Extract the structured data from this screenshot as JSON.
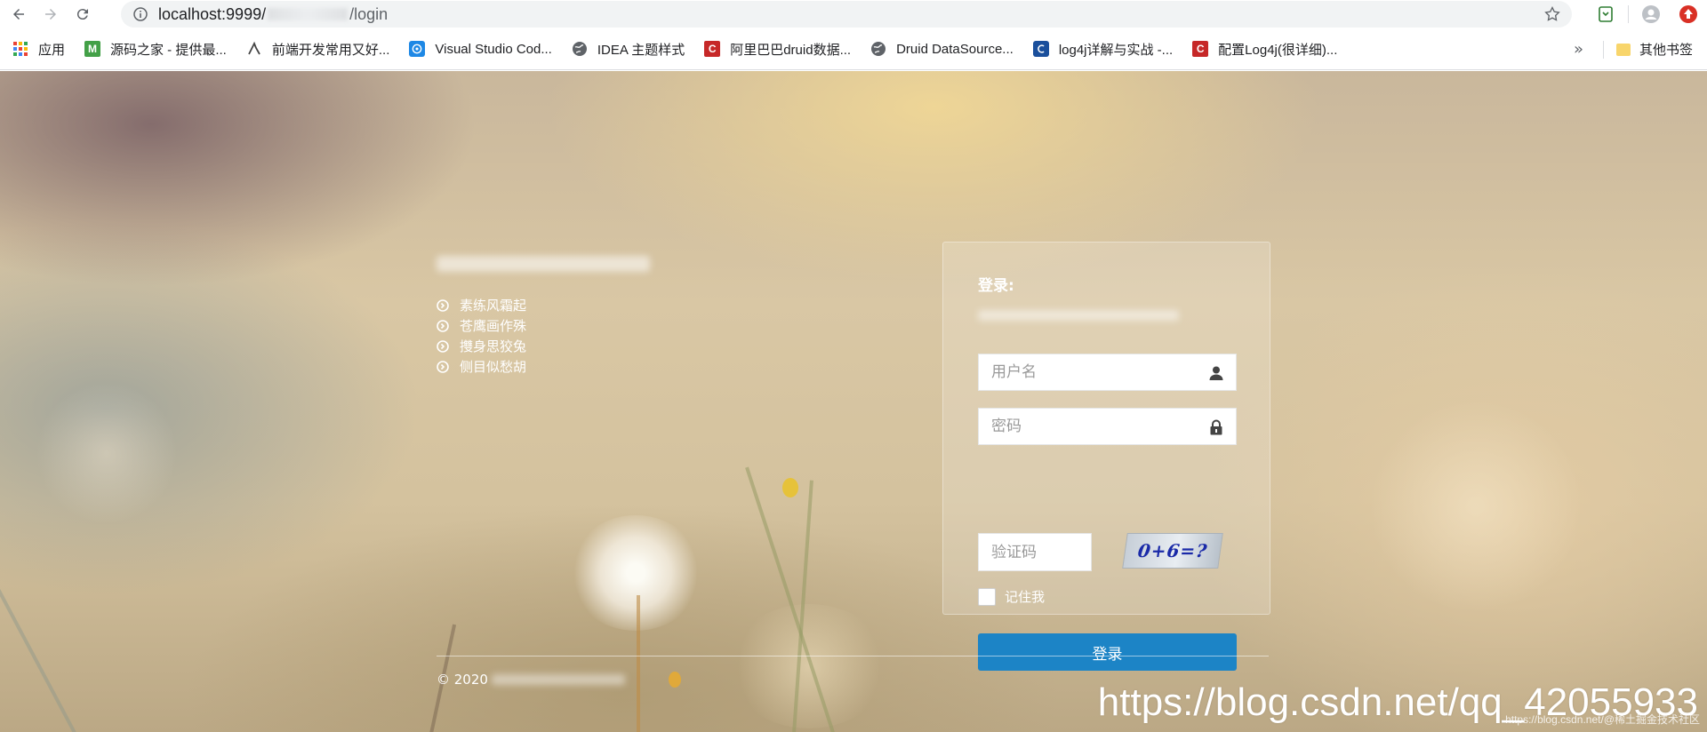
{
  "browser": {
    "url_host": "localhost:9999/",
    "url_path": "/login",
    "bookmarks": [
      {
        "label": "应用",
        "icon": "apps-grid-icon",
        "color": "#4285f4"
      },
      {
        "label": "源码之家 - 提供最...",
        "icon": "m-logo-icon",
        "color": "#43a047"
      },
      {
        "label": "前端开发常用又好...",
        "icon": "script-logo-icon",
        "color": "#444444"
      },
      {
        "label": "Visual Studio Cod...",
        "icon": "vscode-logo-icon",
        "color": "#1e88e5"
      },
      {
        "label": "IDEA 主题样式",
        "icon": "globe-icon",
        "color": "#5f6368"
      },
      {
        "label": "阿里巴巴druid数据...",
        "icon": "csdn-c-icon",
        "color": "#c62828"
      },
      {
        "label": "Druid DataSource...",
        "icon": "globe-icon",
        "color": "#5f6368"
      },
      {
        "label": "log4j详解与实战 -...",
        "icon": "cnblogs-icon",
        "color": "#1a4f9c"
      },
      {
        "label": "配置Log4j(很详细)...",
        "icon": "csdn-c-icon",
        "color": "#c62828"
      }
    ],
    "overflow_label": "»",
    "other_bookmarks": "其他书签"
  },
  "intro": {
    "items": [
      "素练风霜起",
      "苍鹰画作殊",
      "㩳身思狡兔",
      "侧目似愁胡"
    ]
  },
  "login": {
    "title": "登录:",
    "username_placeholder": "用户名",
    "password_placeholder": "密码",
    "captcha_placeholder": "验证码",
    "captcha_text": "0+6=?",
    "remember_label": "记住我",
    "submit_label": "登录"
  },
  "footer": {
    "copyright": "© 2020"
  },
  "watermark": {
    "url": "https://blog.csdn.net/qq_42055933",
    "small": "https://blog.csdn.net/@稀土掘金技术社区"
  },
  "colors": {
    "primary_button": "#1c84c6"
  }
}
